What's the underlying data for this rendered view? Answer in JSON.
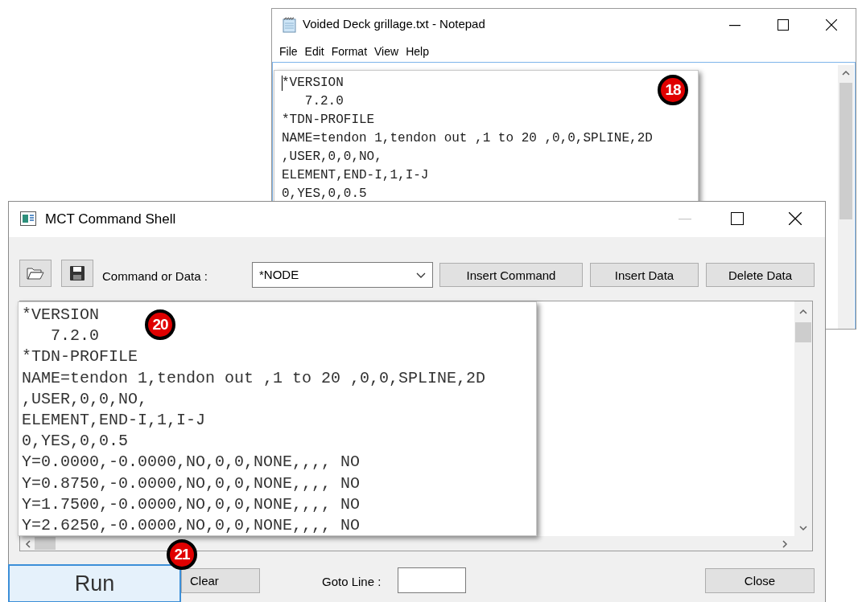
{
  "notepad": {
    "title": "Voided Deck grillage.txt - Notepad",
    "menu": [
      "File",
      "Edit",
      "Format",
      "View",
      "Help"
    ],
    "inset": {
      "badge": "18",
      "lines": [
        "*VERSION",
        "   7.2.0",
        "*TDN-PROFILE",
        "NAME=tendon 1,tendon out ,1 to 20 ,0,0,SPLINE,2D",
        ",USER,0,0,NO,",
        "ELEMENT,END-I,1,I-J",
        "0,YES,0,0.5"
      ]
    }
  },
  "command_shell": {
    "title": "MCT Command Shell",
    "command_label": "Command or Data :",
    "command_value": "*NODE",
    "toolbar_buttons": [
      "Insert Command",
      "Insert Data",
      "Delete Data"
    ],
    "inset": {
      "badge": "20",
      "lines": [
        "*VERSION",
        "   7.2.0",
        "*TDN-PROFILE",
        "NAME=tendon 1,tendon out ,1 to 20 ,0,0,SPLINE,2D",
        ",USER,0,0,NO,",
        "ELEMENT,END-I,1,I-J",
        "0,YES,0,0.5",
        "Y=0.0000,-0.0000,NO,0,0,NONE,,,, NO",
        "Y=0.8750,-0.0000,NO,0,0,NONE,,,, NO",
        "Y=1.7500,-0.0000,NO,0,0,NONE,,,, NO",
        "Y=2.6250,-0.0000,NO,0,0,NONE,,,, NO"
      ]
    },
    "run_button": "Run",
    "run_badge": "21",
    "clear_button": "Clear",
    "goto_label": "Goto Line :",
    "close_button": "Close"
  }
}
